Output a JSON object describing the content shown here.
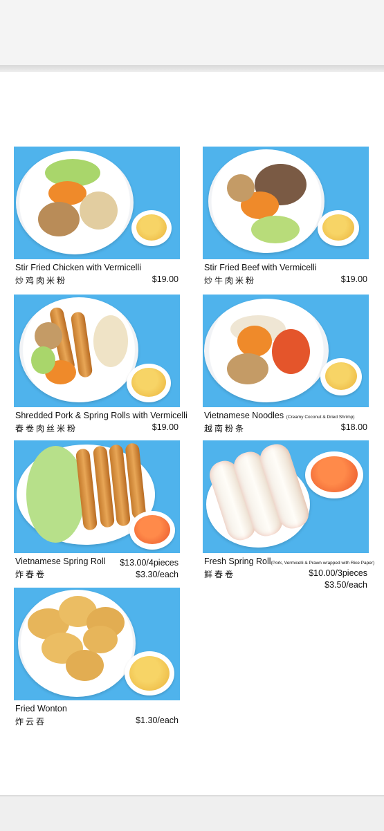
{
  "menu": {
    "items": [
      {
        "name": "Stir Fried Chicken with Vermicelli",
        "chinese": "炒鸡肉米粉",
        "price": "$19.00"
      },
      {
        "name": "Stir Fried Beef with Vermicelli",
        "chinese": "炒牛肉米粉",
        "price": "$19.00"
      },
      {
        "name": "Shredded Pork & Spring Rolls with Vermicelli",
        "chinese": "春卷肉丝米粉",
        "price": "$19.00"
      },
      {
        "name": "Vietnamese Noodles",
        "note": "(Creamy Coconut & Dried Shrimp)",
        "chinese": "越南粉条",
        "price": "$18.00"
      },
      {
        "name": "Vietnamese Spring Roll",
        "chinese": "炸春卷",
        "price": "$13.00/4pieces",
        "price_each": "$3.30/each"
      },
      {
        "name": "Fresh Spring Roll",
        "note": "(Pork, Vermicelli & Prawn wrapped with Rice Paper)",
        "chinese": "鲜春卷",
        "price": "$10.00/3pieces",
        "price_each": "$3.50/each"
      },
      {
        "name": "Fried Wonton",
        "chinese": "炸云吞",
        "price": "$1.30/each"
      }
    ]
  },
  "colors": {
    "photo_background": "#4fb3ec",
    "dipping_sauce": "#f2c14e"
  }
}
